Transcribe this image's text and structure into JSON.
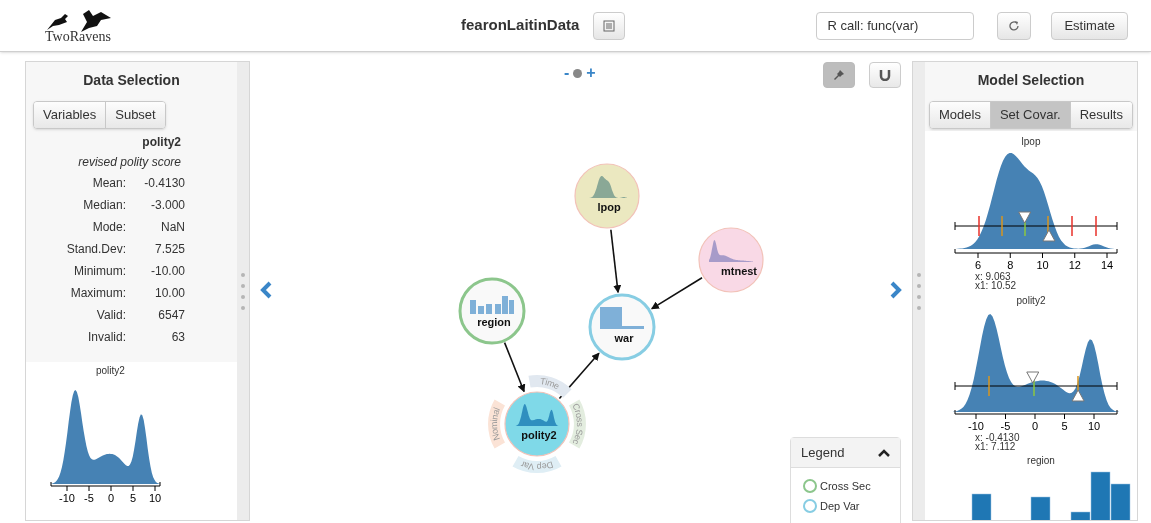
{
  "header": {
    "logo": "TwoRavens",
    "dataset": "fearonLaitinData",
    "rcall_placeholder": "R call: func(var)",
    "estimate": "Estimate"
  },
  "data_selection": {
    "title": "Data Selection",
    "tabs": [
      {
        "label": "Variables",
        "selected": false
      },
      {
        "label": "Subset",
        "selected": false
      }
    ],
    "variable": "polity2",
    "description": "revised polity score",
    "statistics": [
      {
        "label": "Mean:",
        "value": "-0.4130"
      },
      {
        "label": "Median:",
        "value": "-3.000"
      },
      {
        "label": "Mode:",
        "value": "NaN"
      },
      {
        "label": "Stand.Dev:",
        "value": "7.525"
      },
      {
        "label": "Minimum:",
        "value": "-10.00"
      },
      {
        "label": "Maximum:",
        "value": "10.00"
      },
      {
        "label": "Valid:",
        "value": "6547"
      },
      {
        "label": "Invalid:",
        "value": "63"
      }
    ],
    "chart": {
      "title": "polity2",
      "ticks": [
        "-10",
        "-5",
        "0",
        "5",
        "10"
      ]
    }
  },
  "canvas": {
    "zoom_out": "-",
    "zoom_in": "+",
    "pinned": true,
    "nodes": [
      {
        "label": "war",
        "color": "#f9f9f9",
        "cross_sec": false,
        "dep_var": true,
        "kind": "binary",
        "children": [
          {
            "label": "lpop",
            "color": "#ebe8c0",
            "cross_sec": false,
            "dep_var": false,
            "kind": "density"
          },
          {
            "label": "mtnest",
            "color": "#f9d9e6",
            "cross_sec": false,
            "dep_var": false,
            "kind": "skewed"
          },
          {
            "label": "polity2",
            "color": "#7fd9e8",
            "cross_sec": false,
            "dep_var": false,
            "kind": "bimodal",
            "children": [
              {
                "label": "region",
                "color": "#f9f9f9",
                "cross_sec": true,
                "dep_var": false,
                "kind": "bars"
              }
            ]
          }
        ]
      }
    ],
    "node_menu": [
      {
        "label": "Time",
        "color": "#e1e8f0"
      },
      {
        "label": "Cross Sec",
        "color": "#e3eddf"
      },
      {
        "label": "Dep Var",
        "color": "#dfeef5"
      },
      {
        "label": "Nominal",
        "color": "#fbe3d6"
      }
    ],
    "legend": {
      "title": "Legend",
      "expanded": true,
      "items": [
        {
          "label": "Cross Sec",
          "color": "#8cc68c"
        },
        {
          "label": "Dep Var",
          "color": "#87cde3"
        }
      ]
    }
  },
  "model_selection": {
    "title": "Model Selection",
    "tabs": [
      {
        "label": "Models",
        "selected": false
      },
      {
        "label": "Set Covar.",
        "selected": true
      },
      {
        "label": "Results",
        "selected": false
      }
    ],
    "charts": [
      {
        "kind": "density",
        "title": "lpop",
        "ticks": [
          "6",
          "8",
          "10",
          "12",
          "14"
        ],
        "handles": [
          {
            "level": 0.43
          },
          {
            "level": 0.58
          }
        ],
        "x": "x: 9.063",
        "x1": "x1: 10.52"
      },
      {
        "kind": "bimodal",
        "title": "polity2",
        "ticks": [
          "-10",
          "-5",
          "0",
          "5",
          "10"
        ],
        "handles": [
          {
            "level": 0.48
          },
          {
            "level": 0.76
          }
        ],
        "x": "x: -0.4130",
        "x1": "x1: 7.112"
      },
      {
        "kind": "bars",
        "title": "region"
      }
    ]
  }
}
